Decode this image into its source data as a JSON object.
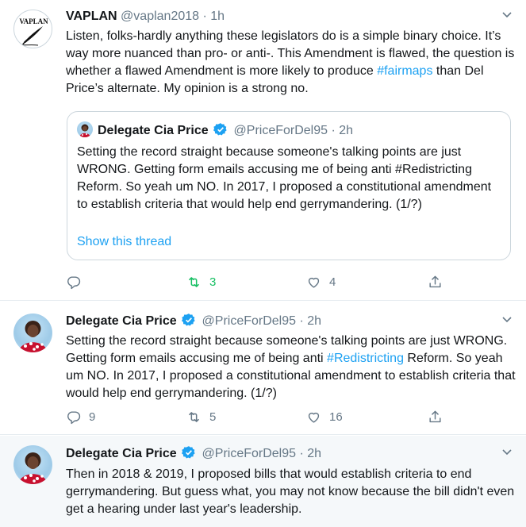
{
  "tweets": [
    {
      "author": {
        "name": "VAPLAN",
        "handle": "@vaplan2018",
        "time": "1h",
        "avatar_text": "VAPLAN"
      },
      "text_parts": [
        "Listen, folks-hardly anything these legislators do is a simple binary choice. It’s way more nuanced than pro- or anti-. This Amendment is flawed, the question is whether a flawed Amendment is more likely to produce ",
        "#fairmaps",
        " than Del Price’s alternate. My opinion is a strong no."
      ],
      "quote": {
        "name": "Delegate Cia Price",
        "handle": "@PriceForDel95",
        "time": "2h",
        "text": "Setting the record straight because someone's talking points are just WRONG.  Getting form emails accusing me of being anti #Redistricting  Reform.  So yeah um NO. In 2017, I proposed a constitutional amendment to establish criteria that would help end gerrymandering. (1/?)",
        "show_thread": "Show this thread"
      },
      "counts": {
        "reply": "",
        "retweet": "3",
        "like": "4"
      }
    },
    {
      "author": {
        "name": "Delegate Cia Price",
        "handle": "@PriceForDel95",
        "time": "2h"
      },
      "text_parts": [
        "Setting the record straight because someone's talking points are just WRONG.  Getting form emails accusing me of being anti ",
        "#Redistricting",
        " Reform.  So yeah um NO. In 2017, I proposed a constitutional amendment to establish criteria that would help end gerrymandering. (1/?)"
      ],
      "counts": {
        "reply": "9",
        "retweet": "5",
        "like": "16"
      }
    },
    {
      "author": {
        "name": "Delegate Cia Price",
        "handle": "@PriceForDel95",
        "time": "2h"
      },
      "text": "Then in 2018 & 2019, I proposed bills that would establish criteria to end gerrymandering.  But guess what, you may not know because the bill didn't even get a hearing under last year's leadership."
    }
  ],
  "separator": "·",
  "colors": {
    "link": "#1da1f2",
    "verified": "#1da1f2",
    "retweeted": "#17bf63",
    "muted": "#657786",
    "highlight_bg": "#f5f8fa"
  }
}
